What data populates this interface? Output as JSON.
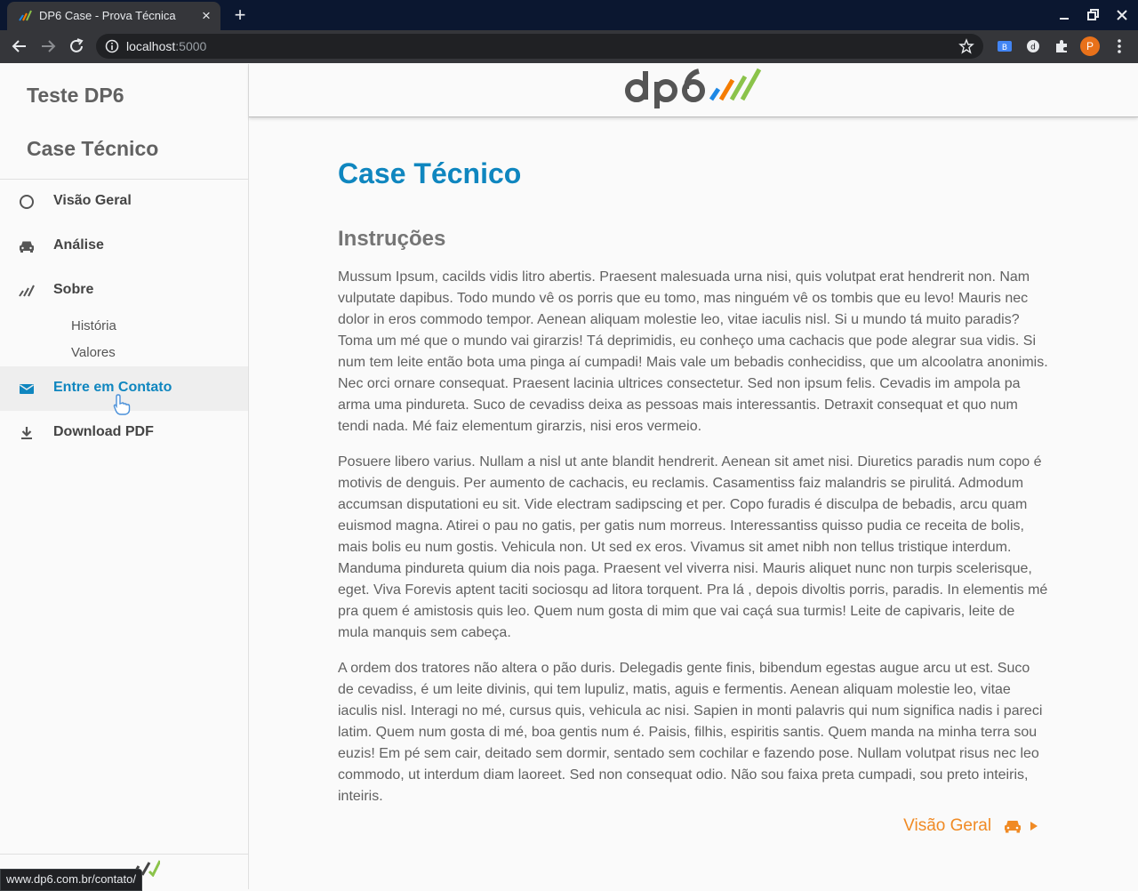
{
  "browser": {
    "tab_title": "DP6 Case - Prova Técnica",
    "url_host": "localhost",
    "url_port": ":5000",
    "profile_initial": "P",
    "status_url": "www.dp6.com.br/contato/"
  },
  "sidebar": {
    "title_1": "Teste DP6",
    "title_2": "Case Técnico",
    "items": [
      {
        "label": "Visão Geral",
        "icon": "circle-outline-icon"
      },
      {
        "label": "Análise",
        "icon": "car-icon"
      },
      {
        "label": "Sobre",
        "icon": "dp6-bars-icon"
      },
      {
        "label": "Entre em Contato",
        "icon": "envelope-icon",
        "active": true
      },
      {
        "label": "Download PDF",
        "icon": "download-icon"
      }
    ],
    "sub_items": [
      "História",
      "Valores"
    ]
  },
  "main": {
    "page_title": "Case Técnico",
    "section_title": "Instruções",
    "paragraphs": [
      "Mussum Ipsum, cacilds vidis litro abertis. Praesent malesuada urna nisi, quis volutpat erat hendrerit non. Nam vulputate dapibus. Todo mundo vê os porris que eu tomo, mas ninguém vê os tombis que eu levo! Mauris nec dolor in eros commodo tempor. Aenean aliquam molestie leo, vitae iaculis nisl. Si u mundo tá muito paradis? Toma um mé que o mundo vai girarzis! Tá deprimidis, eu conheço uma cachacis que pode alegrar sua vidis. Si num tem leite então bota uma pinga aí cumpadi! Mais vale um bebadis conhecidiss, que um alcoolatra anonimis. Nec orci ornare consequat. Praesent lacinia ultrices consectetur. Sed non ipsum felis. Cevadis im ampola pa arma uma pindureta. Suco de cevadiss deixa as pessoas mais interessantis. Detraxit consequat et quo num tendi nada. Mé faiz elementum girarzis, nisi eros vermeio.",
      "Posuere libero varius. Nullam a nisl ut ante blandit hendrerit. Aenean sit amet nisi. Diuretics paradis num copo é motivis de denguis. Per aumento de cachacis, eu reclamis. Casamentiss faiz malandris se pirulitá. Admodum accumsan disputationi eu sit. Vide electram sadipscing et per. Copo furadis é disculpa de bebadis, arcu quam euismod magna. Atirei o pau no gatis, per gatis num morreus. Interessantiss quisso pudia ce receita de bolis, mais bolis eu num gostis. Vehicula non. Ut sed ex eros. Vivamus sit amet nibh non tellus tristique interdum. Manduma pindureta quium dia nois paga. Praesent vel viverra nisi. Mauris aliquet nunc non turpis scelerisque, eget. Viva Forevis aptent taciti sociosqu ad litora torquent. Pra lá , depois divoltis porris, paradis. In elementis mé pra quem é amistosis quis leo. Quem num gosta di mim que vai caçá sua turmis! Leite de capivaris, leite de mula manquis sem cabeça.",
      "A ordem dos tratores não altera o pão duris. Delegadis gente finis, bibendum egestas augue arcu ut est. Suco de cevadiss, é um leite divinis, qui tem lupuliz, matis, aguis e fermentis. Aenean aliquam molestie leo, vitae iaculis nisl. Interagi no mé, cursus quis, vehicula ac nisi. Sapien in monti palavris qui num significa nadis i pareci latim. Quem num gosta di mé, boa gentis num é. Paisis, filhis, espiritis santis. Quem manda na minha terra sou euzis! Em pé sem cair, deitado sem dormir, sentado sem cochilar e fazendo pose. Nullam volutpat risus nec leo commodo, ut interdum diam laoreet. Sed non consequat odio. Não sou faixa preta cumpadi, sou preto inteiris, inteiris."
    ],
    "next_link_label": "Visão Geral"
  },
  "colors": {
    "accent_blue": "#0f86bf",
    "accent_orange": "#f08a24",
    "text_gray": "#616161"
  }
}
